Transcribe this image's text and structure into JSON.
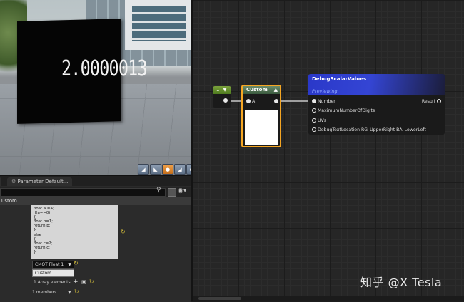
{
  "viewport": {
    "display_value": "2.0000013",
    "toolbar_icons": [
      "camera-icon",
      "perspective-icon",
      "lit-mode-icon",
      "show-flags-icon",
      "realtime-icon"
    ]
  },
  "details": {
    "tabs": [
      "Parameter Default..."
    ],
    "search": {
      "placeholder": ""
    },
    "category": "Custom",
    "code_lines": "float a =A;\nif(a==0)\n{\nfloat b=1;\nreturn b;\n}\nelse\n{\nfloat c=2;\nreturn c;\n}",
    "output_type": "CMOT Float 1",
    "description": "Custom",
    "inputs_array": "1 Array elements",
    "members": "1 members"
  },
  "graph": {
    "constant_node": {
      "value": "1"
    },
    "custom_node": {
      "title": "Custom",
      "input": "A"
    },
    "debug_node": {
      "title": "DebugScalarValues",
      "status": "Previewing",
      "output": "Result",
      "inputs": [
        "Number",
        "MaximumNumberOfDigits",
        "UVs",
        "DebugTextLocation RG_UpperRight BA_LowerLeft"
      ]
    }
  },
  "watermark": "知乎 @X Tesla",
  "colors": {
    "selection_outline": "#f5a623",
    "constant_header": "#6a9a2e",
    "debug_header": "#2f3fcc",
    "previewing_text": "#8fa6ff"
  }
}
